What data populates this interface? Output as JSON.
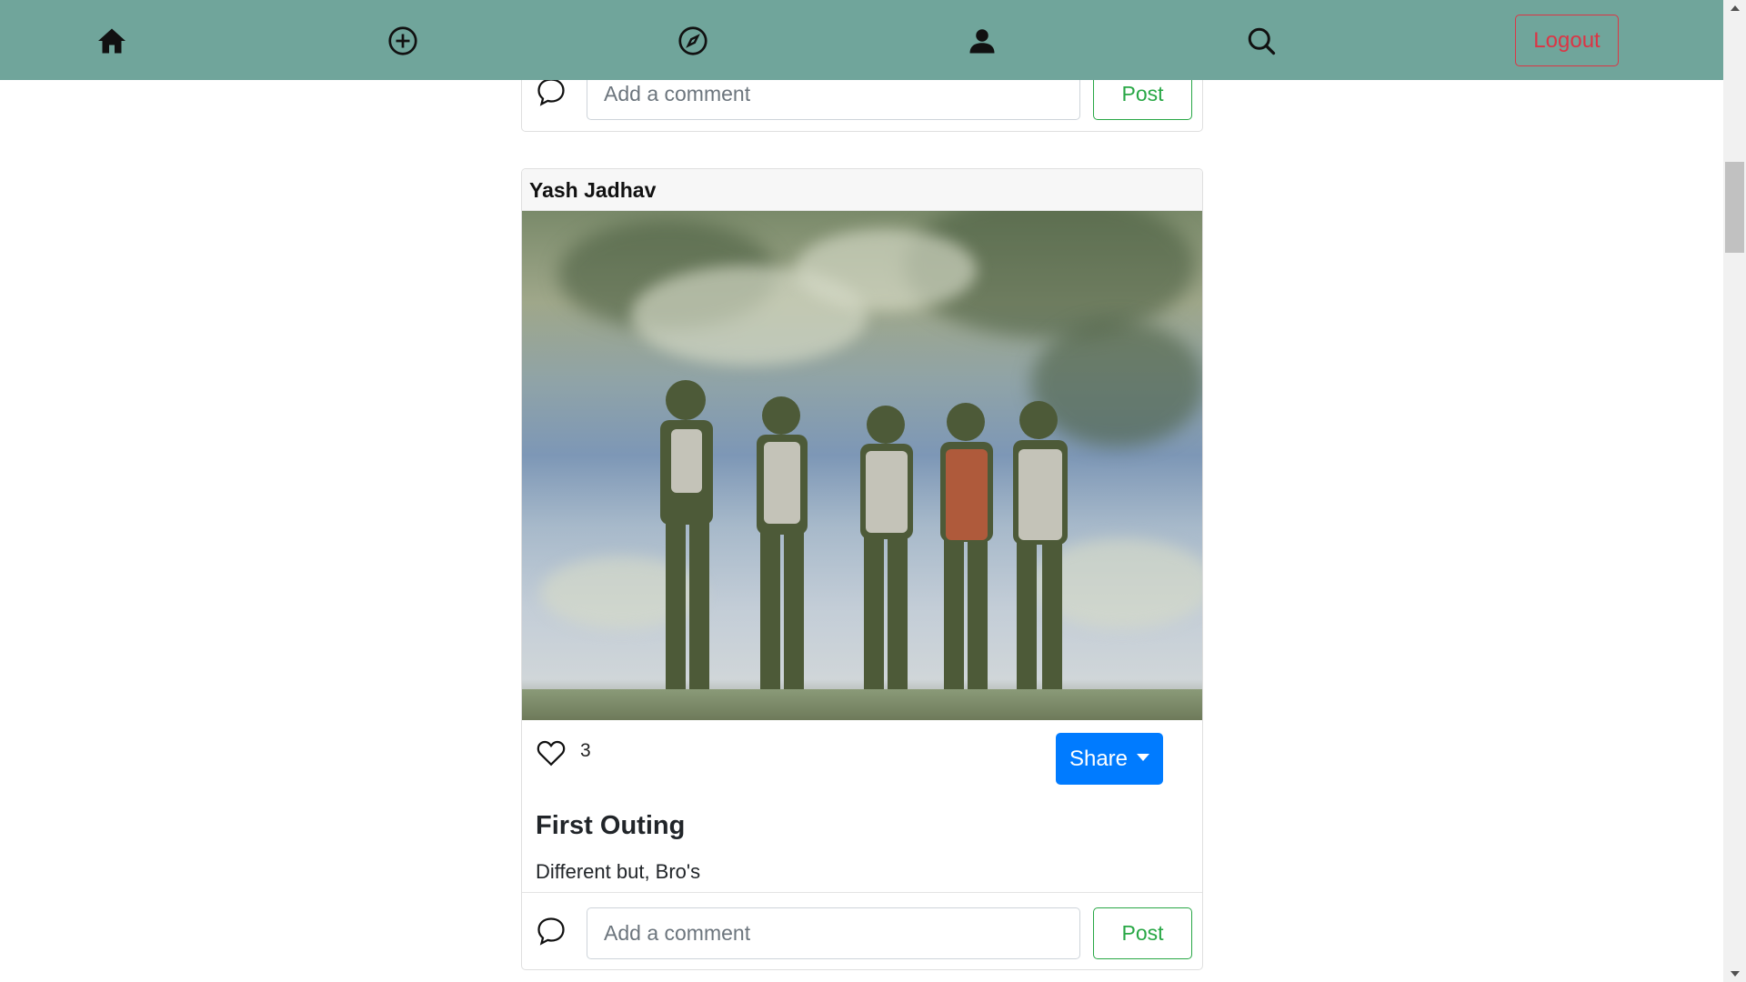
{
  "nav": {
    "items": [
      {
        "name": "home-icon"
      },
      {
        "name": "add-circle-icon"
      },
      {
        "name": "compass-icon"
      },
      {
        "name": "person-icon"
      },
      {
        "name": "search-icon"
      }
    ],
    "logout_label": "Logout"
  },
  "colors": {
    "navbar": "#70a59b",
    "logout": "#dc3545",
    "share": "#007bff",
    "post": "#28a745"
  },
  "top_card": {
    "comment_placeholder": "Add a comment",
    "post_label": "Post"
  },
  "post": {
    "author": "Yash Jadhav",
    "likes": "3",
    "share_label": "Share",
    "title": "First Outing",
    "description": "Different but, Bro's",
    "comment_placeholder": "Add a comment",
    "post_label": "Post"
  }
}
